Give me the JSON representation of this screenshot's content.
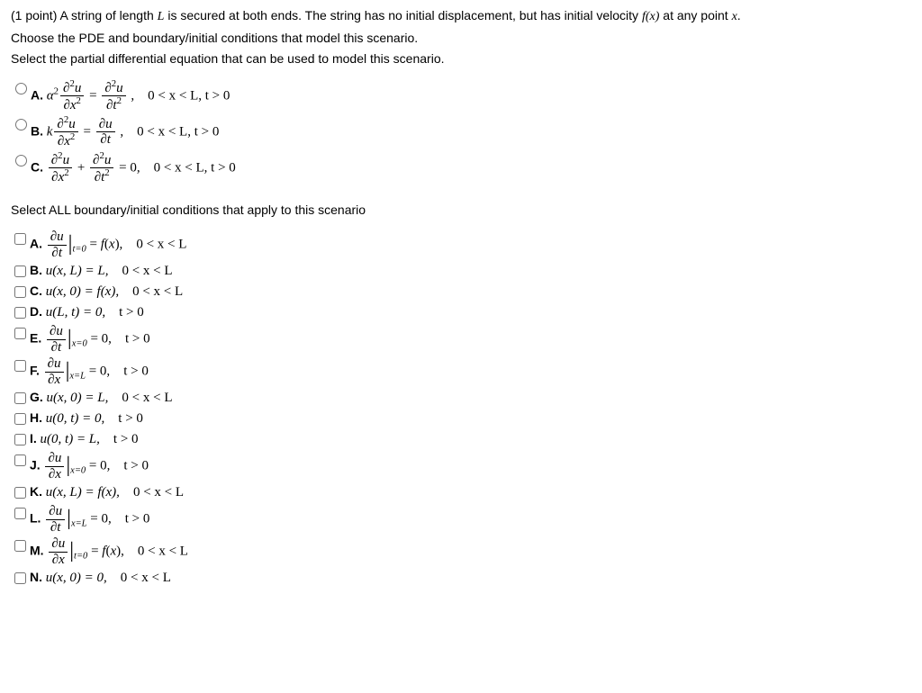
{
  "question": {
    "points": "(1 point)",
    "text_part1": "A string of length",
    "lengthVar": "L",
    "text_part2": "is secured at both ends. The string has no initial displacement, but has initial velocity",
    "velFunc": "f(x)",
    "text_part3": "at any point",
    "pointVar": "x",
    "text_part4": "."
  },
  "line2": "Choose the PDE and boundary/initial conditions that model this scenario.",
  "line3": "Select the partial differential equation that can be used to model this scenario.",
  "pde": {
    "A": {
      "label": "A.",
      "domain": "0 < x < L, t > 0"
    },
    "B": {
      "label": "B.",
      "domain": "0 < x < L, t > 0"
    },
    "C": {
      "label": "C.",
      "domain": "0 < x < L, t > 0"
    }
  },
  "section2": "Select ALL boundary/initial conditions that apply to this scenario",
  "bc": {
    "A": {
      "label": "A.",
      "domain": "0 < x < L"
    },
    "B": {
      "label": "B.",
      "eq": "u(x, L) = L,",
      "domain": "0 < x < L"
    },
    "C": {
      "label": "C.",
      "eq": "u(x, 0) = f(x),",
      "domain": "0 < x < L"
    },
    "D": {
      "label": "D.",
      "eq": "u(L, t) = 0,",
      "domain": "t > 0"
    },
    "E": {
      "label": "E.",
      "domain": "t > 0"
    },
    "F": {
      "label": "F.",
      "domain": "t > 0"
    },
    "G": {
      "label": "G.",
      "eq": "u(x, 0) = L,",
      "domain": "0 < x < L"
    },
    "H": {
      "label": "H.",
      "eq": "u(0, t) = 0,",
      "domain": "t > 0"
    },
    "I": {
      "label": "I.",
      "eq": "u(0, t) = L,",
      "domain": "t > 0"
    },
    "J": {
      "label": "J.",
      "domain": "t > 0"
    },
    "K": {
      "label": "K.",
      "eq": "u(x, L) = f(x),",
      "domain": "0 < x < L"
    },
    "L": {
      "label": "L.",
      "domain": "t > 0"
    },
    "M": {
      "label": "M.",
      "domain": "0 < x < L"
    },
    "N": {
      "label": "N.",
      "eq": "u(x, 0) = 0,",
      "domain": "0 < x < L"
    }
  }
}
